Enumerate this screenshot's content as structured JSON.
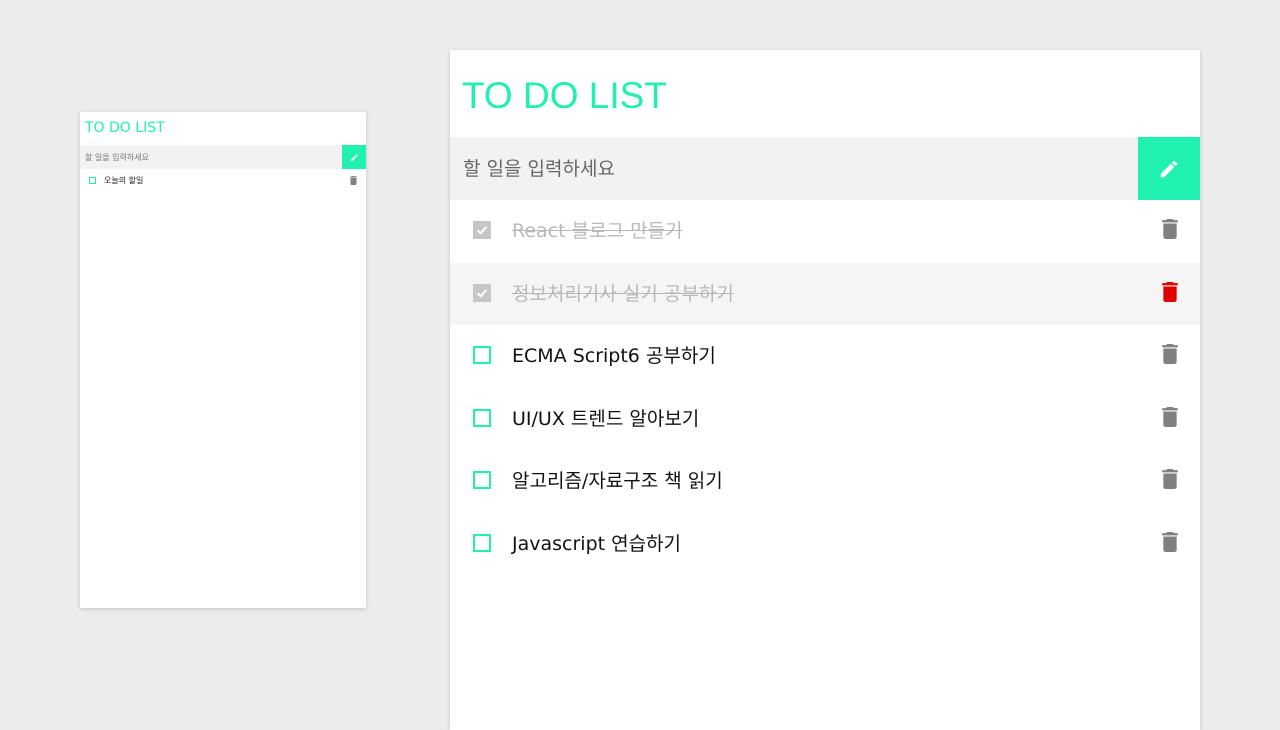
{
  "colors": {
    "accent": "#20f0b0",
    "background": "#ececec",
    "card": "#ffffff",
    "input_bg": "#f2f2f2",
    "done_text": "#b9b9b9",
    "trash": "#808080",
    "trash_hover": "#e00000"
  },
  "small_app": {
    "title": "TO DO LIST",
    "input": {
      "placeholder": "할 일을 입력하세요",
      "value": ""
    },
    "add_button_icon": "pencil-icon",
    "items": [
      {
        "text": "오늘의 할일",
        "done": false,
        "icon": "trash-icon"
      }
    ]
  },
  "large_app": {
    "title": "TO DO LIST",
    "input": {
      "placeholder": "할 일을 입력하세요",
      "value": ""
    },
    "add_button_icon": "pencil-icon",
    "items": [
      {
        "text": "React 블로그 만들기",
        "done": true,
        "hovered": false
      },
      {
        "text": "정보처리기사 실기 공부하기",
        "done": true,
        "hovered": true
      },
      {
        "text": "ECMA Script6 공부하기",
        "done": false,
        "hovered": false
      },
      {
        "text": "UI/UX 트렌드 알아보기",
        "done": false,
        "hovered": false
      },
      {
        "text": "알고리즘/자료구조 책 읽기",
        "done": false,
        "hovered": false
      },
      {
        "text": "Javascript 연습하기",
        "done": false,
        "hovered": false
      }
    ]
  }
}
